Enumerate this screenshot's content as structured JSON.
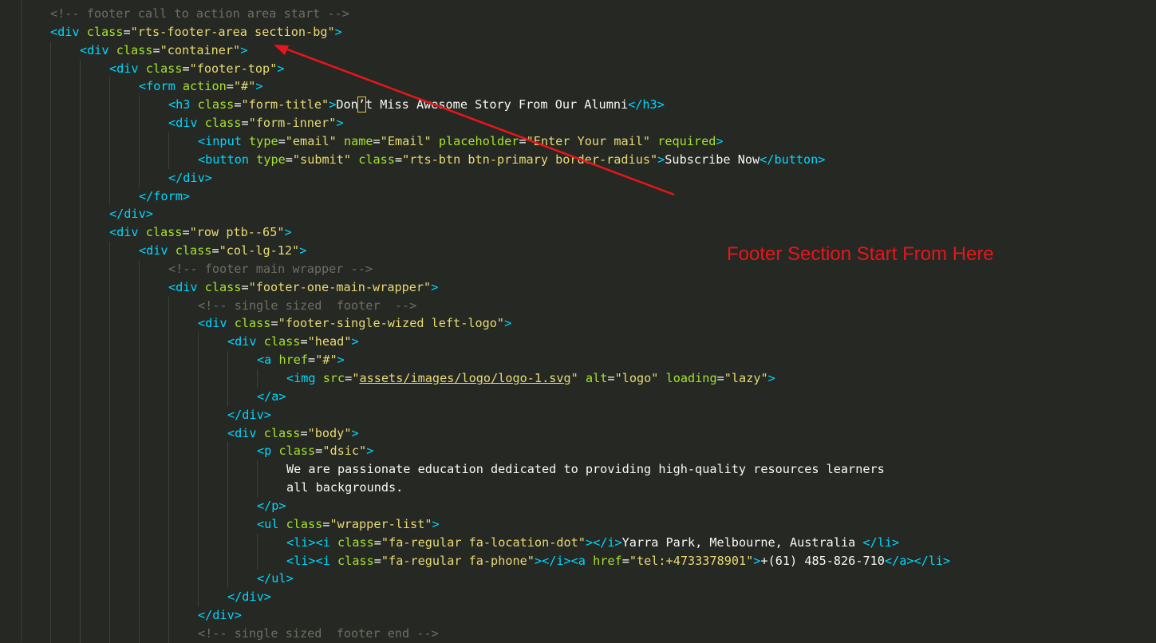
{
  "annotation": {
    "text": "Footer Section Start From Here",
    "color": "#e8161c"
  },
  "colors": {
    "background": "#262823",
    "tag": "#00d7ff",
    "attribute": "#a6e22e",
    "string": "#a6e22e",
    "comment": "#6e6e63",
    "text": "#f8f8f2",
    "arrow": "#e8161c"
  },
  "lines": [
    {
      "indent": 1,
      "parts": [
        [
          "cm",
          "<!-- footer call to action area start -->"
        ]
      ]
    },
    {
      "indent": 1,
      "parts": [
        [
          "tag",
          "<div"
        ],
        [
          "tx",
          " "
        ],
        [
          "atk",
          "class"
        ],
        [
          "tx",
          "="
        ],
        [
          "str",
          "\"rts-footer-area section-bg\""
        ],
        [
          "tag",
          ">"
        ]
      ]
    },
    {
      "indent": 2,
      "parts": [
        [
          "tag",
          "<div"
        ],
        [
          "tx",
          " "
        ],
        [
          "atk",
          "class"
        ],
        [
          "tx",
          "="
        ],
        [
          "str",
          "\"container\""
        ],
        [
          "tag",
          ">"
        ]
      ]
    },
    {
      "indent": 3,
      "parts": [
        [
          "tag",
          "<div"
        ],
        [
          "tx",
          " "
        ],
        [
          "atk",
          "class"
        ],
        [
          "tx",
          "="
        ],
        [
          "str",
          "\"footer-top\""
        ],
        [
          "tag",
          ">"
        ]
      ]
    },
    {
      "indent": 4,
      "parts": [
        [
          "tag",
          "<form"
        ],
        [
          "tx",
          " "
        ],
        [
          "atk",
          "action"
        ],
        [
          "tx",
          "="
        ],
        [
          "str",
          "\"#\""
        ],
        [
          "tag",
          ">"
        ]
      ]
    },
    {
      "indent": 5,
      "parts": [
        [
          "tag",
          "<h3"
        ],
        [
          "tx",
          " "
        ],
        [
          "atk",
          "class"
        ],
        [
          "tx",
          "="
        ],
        [
          "str",
          "\"form-title\""
        ],
        [
          "tag",
          ">"
        ],
        [
          "tx",
          "Don"
        ],
        [
          "cursor",
          "’"
        ],
        [
          "tx",
          "t Miss Awesome Story From Our Alumni"
        ],
        [
          "tag",
          "</h3>"
        ]
      ]
    },
    {
      "indent": 5,
      "parts": [
        [
          "tag",
          "<div"
        ],
        [
          "tx",
          " "
        ],
        [
          "atk",
          "class"
        ],
        [
          "tx",
          "="
        ],
        [
          "str",
          "\"form-inner\""
        ],
        [
          "tag",
          ">"
        ]
      ]
    },
    {
      "indent": 6,
      "parts": [
        [
          "tag",
          "<input"
        ],
        [
          "tx",
          " "
        ],
        [
          "atk",
          "type"
        ],
        [
          "tx",
          "="
        ],
        [
          "str",
          "\"email\""
        ],
        [
          "tx",
          " "
        ],
        [
          "atk",
          "name"
        ],
        [
          "tx",
          "="
        ],
        [
          "str",
          "\"Email\""
        ],
        [
          "tx",
          " "
        ],
        [
          "atk",
          "placeholder"
        ],
        [
          "tx",
          "="
        ],
        [
          "str",
          "\"Enter Your mail\""
        ],
        [
          "tx",
          " "
        ],
        [
          "atk",
          "required"
        ],
        [
          "tag",
          ">"
        ]
      ]
    },
    {
      "indent": 6,
      "parts": [
        [
          "tag",
          "<button"
        ],
        [
          "tx",
          " "
        ],
        [
          "atk",
          "type"
        ],
        [
          "tx",
          "="
        ],
        [
          "str",
          "\"submit\""
        ],
        [
          "tx",
          " "
        ],
        [
          "atk",
          "class"
        ],
        [
          "tx",
          "="
        ],
        [
          "str",
          "\"rts-btn btn-primary border-radius\""
        ],
        [
          "tag",
          ">"
        ],
        [
          "tx",
          "Subscribe Now"
        ],
        [
          "tag",
          "</button>"
        ]
      ]
    },
    {
      "indent": 5,
      "parts": [
        [
          "tag",
          "</div>"
        ]
      ]
    },
    {
      "indent": 4,
      "parts": [
        [
          "tag",
          "</form>"
        ]
      ]
    },
    {
      "indent": 3,
      "parts": [
        [
          "tag",
          "</div>"
        ]
      ]
    },
    {
      "indent": 3,
      "parts": [
        [
          "tag",
          "<div"
        ],
        [
          "tx",
          " "
        ],
        [
          "atk",
          "class"
        ],
        [
          "tx",
          "="
        ],
        [
          "str",
          "\"row ptb--65\""
        ],
        [
          "tag",
          ">"
        ]
      ]
    },
    {
      "indent": 4,
      "parts": [
        [
          "tag",
          "<div"
        ],
        [
          "tx",
          " "
        ],
        [
          "atk",
          "class"
        ],
        [
          "tx",
          "="
        ],
        [
          "str",
          "\"col-lg-12\""
        ],
        [
          "tag",
          ">"
        ]
      ]
    },
    {
      "indent": 5,
      "parts": [
        [
          "cm",
          "<!-- footer main wrapper -->"
        ]
      ]
    },
    {
      "indent": 5,
      "parts": [
        [
          "tag",
          "<div"
        ],
        [
          "tx",
          " "
        ],
        [
          "atk",
          "class"
        ],
        [
          "tx",
          "="
        ],
        [
          "str",
          "\"footer-one-main-wrapper\""
        ],
        [
          "tag",
          ">"
        ]
      ]
    },
    {
      "indent": 6,
      "parts": [
        [
          "cm",
          "<!-- single sized  footer  -->"
        ]
      ]
    },
    {
      "indent": 6,
      "parts": [
        [
          "tag",
          "<div"
        ],
        [
          "tx",
          " "
        ],
        [
          "atk",
          "class"
        ],
        [
          "tx",
          "="
        ],
        [
          "str",
          "\"footer-single-wized left-logo\""
        ],
        [
          "tag",
          ">"
        ]
      ]
    },
    {
      "indent": 7,
      "parts": [
        [
          "tag",
          "<div"
        ],
        [
          "tx",
          " "
        ],
        [
          "atk",
          "class"
        ],
        [
          "tx",
          "="
        ],
        [
          "str",
          "\"head\""
        ],
        [
          "tag",
          ">"
        ]
      ]
    },
    {
      "indent": 8,
      "parts": [
        [
          "tag",
          "<a"
        ],
        [
          "tx",
          " "
        ],
        [
          "atk",
          "href"
        ],
        [
          "tx",
          "="
        ],
        [
          "str",
          "\"#\""
        ],
        [
          "tag",
          ">"
        ]
      ]
    },
    {
      "indent": 9,
      "parts": [
        [
          "tag",
          "<img"
        ],
        [
          "tx",
          " "
        ],
        [
          "atk",
          "src"
        ],
        [
          "tx",
          "="
        ],
        [
          "str",
          "\""
        ],
        [
          "stru",
          "assets/images/logo/logo-1.svg"
        ],
        [
          "str",
          "\""
        ],
        [
          "tx",
          " "
        ],
        [
          "atk",
          "alt"
        ],
        [
          "tx",
          "="
        ],
        [
          "str",
          "\"logo\""
        ],
        [
          "tx",
          " "
        ],
        [
          "atk",
          "loading"
        ],
        [
          "tx",
          "="
        ],
        [
          "str",
          "\"lazy\""
        ],
        [
          "tag",
          ">"
        ]
      ]
    },
    {
      "indent": 8,
      "parts": [
        [
          "tag",
          "</a>"
        ]
      ]
    },
    {
      "indent": 7,
      "parts": [
        [
          "tag",
          "</div>"
        ]
      ]
    },
    {
      "indent": 7,
      "parts": [
        [
          "tag",
          "<div"
        ],
        [
          "tx",
          " "
        ],
        [
          "atk",
          "class"
        ],
        [
          "tx",
          "="
        ],
        [
          "str",
          "\"body\""
        ],
        [
          "tag",
          ">"
        ]
      ]
    },
    {
      "indent": 8,
      "parts": [
        [
          "tag",
          "<p"
        ],
        [
          "tx",
          " "
        ],
        [
          "atk",
          "class"
        ],
        [
          "tx",
          "="
        ],
        [
          "str",
          "\"dsic\""
        ],
        [
          "tag",
          ">"
        ]
      ]
    },
    {
      "indent": 9,
      "parts": [
        [
          "tx",
          "We are passionate education dedicated to providing high-quality resources learners"
        ]
      ]
    },
    {
      "indent": 9,
      "parts": [
        [
          "tx",
          "all backgrounds."
        ]
      ]
    },
    {
      "indent": 8,
      "parts": [
        [
          "tag",
          "</p>"
        ]
      ]
    },
    {
      "indent": 8,
      "parts": [
        [
          "tag",
          "<ul"
        ],
        [
          "tx",
          " "
        ],
        [
          "atk",
          "class"
        ],
        [
          "tx",
          "="
        ],
        [
          "str",
          "\"wrapper-list\""
        ],
        [
          "tag",
          ">"
        ]
      ]
    },
    {
      "indent": 9,
      "parts": [
        [
          "tag",
          "<li><i"
        ],
        [
          "tx",
          " "
        ],
        [
          "atk",
          "class"
        ],
        [
          "tx",
          "="
        ],
        [
          "str",
          "\"fa-regular fa-location-dot\""
        ],
        [
          "tag",
          "></i>"
        ],
        [
          "tx",
          "Yarra Park, Melbourne, Australia "
        ],
        [
          "tag",
          "</li>"
        ]
      ]
    },
    {
      "indent": 9,
      "parts": [
        [
          "tag",
          "<li><i"
        ],
        [
          "tx",
          " "
        ],
        [
          "atk",
          "class"
        ],
        [
          "tx",
          "="
        ],
        [
          "str",
          "\"fa-regular fa-phone\""
        ],
        [
          "tag",
          "></i><a"
        ],
        [
          "tx",
          " "
        ],
        [
          "atk",
          "href"
        ],
        [
          "tx",
          "="
        ],
        [
          "str",
          "\"tel:+4733378901\""
        ],
        [
          "tag",
          ">"
        ],
        [
          "tx",
          "+(61) 485-826-710"
        ],
        [
          "tag",
          "</a></li>"
        ]
      ]
    },
    {
      "indent": 8,
      "parts": [
        [
          "tag",
          "</ul>"
        ]
      ]
    },
    {
      "indent": 7,
      "parts": [
        [
          "tag",
          "</div>"
        ]
      ]
    },
    {
      "indent": 6,
      "parts": [
        [
          "tag",
          "</div>"
        ]
      ]
    },
    {
      "indent": 6,
      "parts": [
        [
          "cm",
          "<!-- single sized  footer end -->"
        ]
      ]
    }
  ]
}
